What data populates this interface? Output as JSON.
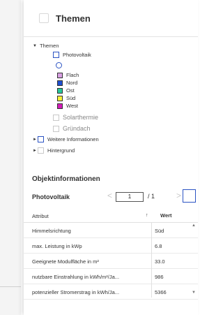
{
  "panel": {
    "title": "Themen"
  },
  "tree": {
    "root": "Themen",
    "photovoltaik": "Photovoltaik",
    "legend": [
      {
        "label": "Flach",
        "color": "#d9a0e3"
      },
      {
        "label": "Nord",
        "color": "#1f4fd1"
      },
      {
        "label": "Ost",
        "color": "#25c79a"
      },
      {
        "label": "Süd",
        "color": "#f7f23a"
      },
      {
        "label": "West",
        "color": "#d41bb8"
      }
    ],
    "solarthermie": "Solarthermie",
    "gruendach": "Gründach",
    "weitere": "Weitere Informationen",
    "hintergrund": "Hintergrund"
  },
  "objektinfo": {
    "title": "Objektinformationen",
    "layer": "Photovoltaik",
    "page_current": "1",
    "page_total": "/ 1",
    "prev": "<",
    "next": ">"
  },
  "table": {
    "col_attr": "Attribut",
    "sort": "↑",
    "col_wert": "Wert",
    "rows": [
      {
        "attr": "Himmelsrichtung",
        "wert": "Süd"
      },
      {
        "attr": "max. Leistung in kWp",
        "wert": "6.8"
      },
      {
        "attr": "Geeignete Modulfläche in m²",
        "wert": "33.0"
      },
      {
        "attr": "nutzbare Einstrahlung in kWh/m²/Ja...",
        "wert": "986"
      },
      {
        "attr": "potenzieller Stromerstrag in kWh/Ja...",
        "wert": "5366"
      }
    ]
  }
}
